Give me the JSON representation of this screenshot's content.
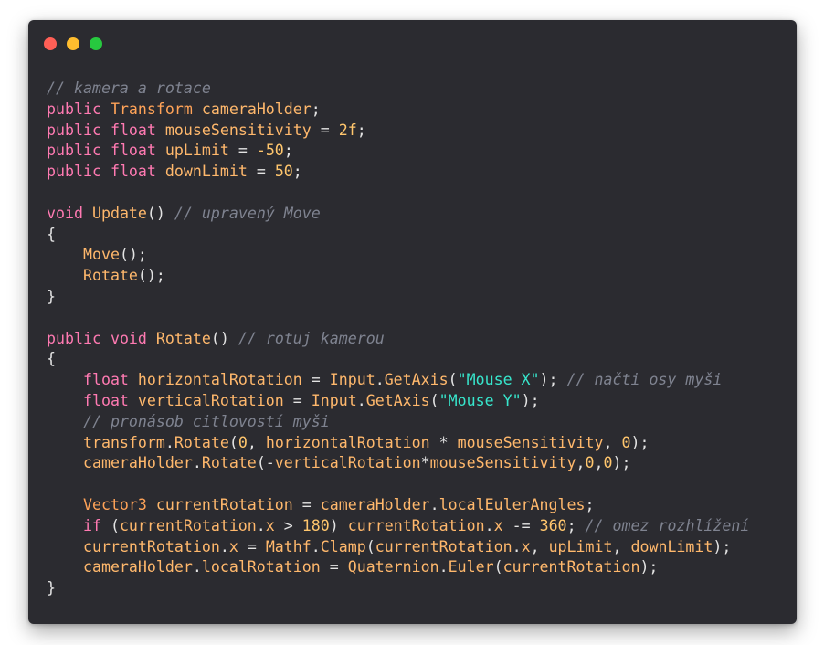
{
  "window": {
    "controls": [
      {
        "name": "close",
        "color": "#ff5f56"
      },
      {
        "name": "minimize",
        "color": "#ffbd2e"
      },
      {
        "name": "maximize",
        "color": "#27c93f"
      }
    ]
  },
  "colors": {
    "background": "#2b2b30",
    "keyword": "#ff7ab2",
    "identifier": "#ffb86c",
    "number": "#ffc66d",
    "string": "#37e6cc",
    "comment": "#7f8390",
    "plain": "#e3e3e3"
  },
  "code": {
    "lines": [
      [
        [
          "cm",
          "// kamera a rotace"
        ]
      ],
      [
        [
          "kw",
          "public"
        ],
        [
          "pl",
          " "
        ],
        [
          "ty",
          "Transform"
        ],
        [
          "pl",
          " "
        ],
        [
          "id",
          "cameraHolder"
        ],
        [
          "pl",
          ";"
        ]
      ],
      [
        [
          "kw",
          "public"
        ],
        [
          "pl",
          " "
        ],
        [
          "kw",
          "float"
        ],
        [
          "pl",
          " "
        ],
        [
          "id",
          "mouseSensitivity"
        ],
        [
          "pl",
          " = "
        ],
        [
          "nm",
          "2f"
        ],
        [
          "pl",
          ";"
        ]
      ],
      [
        [
          "kw",
          "public"
        ],
        [
          "pl",
          " "
        ],
        [
          "kw",
          "float"
        ],
        [
          "pl",
          " "
        ],
        [
          "id",
          "upLimit"
        ],
        [
          "pl",
          " = "
        ],
        [
          "nm",
          "-50"
        ],
        [
          "pl",
          ";"
        ]
      ],
      [
        [
          "kw",
          "public"
        ],
        [
          "pl",
          " "
        ],
        [
          "kw",
          "float"
        ],
        [
          "pl",
          " "
        ],
        [
          "id",
          "downLimit"
        ],
        [
          "pl",
          " = "
        ],
        [
          "nm",
          "50"
        ],
        [
          "pl",
          ";"
        ]
      ],
      [],
      [
        [
          "kw",
          "void"
        ],
        [
          "pl",
          " "
        ],
        [
          "fn",
          "Update"
        ],
        [
          "pl",
          "() "
        ],
        [
          "cm",
          "// upravený Move"
        ]
      ],
      [
        [
          "pl",
          "{"
        ]
      ],
      [
        [
          "pl",
          "    "
        ],
        [
          "fn",
          "Move"
        ],
        [
          "pl",
          "();"
        ]
      ],
      [
        [
          "pl",
          "    "
        ],
        [
          "fn",
          "Rotate"
        ],
        [
          "pl",
          "();"
        ]
      ],
      [
        [
          "pl",
          "}"
        ]
      ],
      [],
      [
        [
          "kw",
          "public"
        ],
        [
          "pl",
          " "
        ],
        [
          "kw",
          "void"
        ],
        [
          "pl",
          " "
        ],
        [
          "fn",
          "Rotate"
        ],
        [
          "pl",
          "() "
        ],
        [
          "cm",
          "// rotuj kamerou"
        ]
      ],
      [
        [
          "pl",
          "{"
        ]
      ],
      [
        [
          "pl",
          "    "
        ],
        [
          "kw",
          "float"
        ],
        [
          "pl",
          " "
        ],
        [
          "id",
          "horizontalRotation"
        ],
        [
          "pl",
          " = "
        ],
        [
          "id",
          "Input"
        ],
        [
          "pl",
          "."
        ],
        [
          "fn",
          "GetAxis"
        ],
        [
          "pl",
          "("
        ],
        [
          "st",
          "\"Mouse X\""
        ],
        [
          "pl",
          "); "
        ],
        [
          "cm",
          "// načti osy myši"
        ]
      ],
      [
        [
          "pl",
          "    "
        ],
        [
          "kw",
          "float"
        ],
        [
          "pl",
          " "
        ],
        [
          "id",
          "verticalRotation"
        ],
        [
          "pl",
          " = "
        ],
        [
          "id",
          "Input"
        ],
        [
          "pl",
          "."
        ],
        [
          "fn",
          "GetAxis"
        ],
        [
          "pl",
          "("
        ],
        [
          "st",
          "\"Mouse Y\""
        ],
        [
          "pl",
          ");"
        ]
      ],
      [
        [
          "pl",
          "    "
        ],
        [
          "cm",
          "// pronásob citlovostí myši"
        ]
      ],
      [
        [
          "pl",
          "    "
        ],
        [
          "id",
          "transform"
        ],
        [
          "pl",
          "."
        ],
        [
          "fn",
          "Rotate"
        ],
        [
          "pl",
          "("
        ],
        [
          "nm",
          "0"
        ],
        [
          "pl",
          ", "
        ],
        [
          "id",
          "horizontalRotation"
        ],
        [
          "pl",
          " * "
        ],
        [
          "id",
          "mouseSensitivity"
        ],
        [
          "pl",
          ", "
        ],
        [
          "nm",
          "0"
        ],
        [
          "pl",
          ");"
        ]
      ],
      [
        [
          "pl",
          "    "
        ],
        [
          "id",
          "cameraHolder"
        ],
        [
          "pl",
          "."
        ],
        [
          "fn",
          "Rotate"
        ],
        [
          "pl",
          "(-"
        ],
        [
          "id",
          "verticalRotation"
        ],
        [
          "pl",
          "*"
        ],
        [
          "id",
          "mouseSensitivity"
        ],
        [
          "pl",
          ","
        ],
        [
          "nm",
          "0"
        ],
        [
          "pl",
          ","
        ],
        [
          "nm",
          "0"
        ],
        [
          "pl",
          ");"
        ]
      ],
      [],
      [
        [
          "pl",
          "    "
        ],
        [
          "ty",
          "Vector3"
        ],
        [
          "pl",
          " "
        ],
        [
          "id",
          "currentRotation"
        ],
        [
          "pl",
          " = "
        ],
        [
          "id",
          "cameraHolder"
        ],
        [
          "pl",
          "."
        ],
        [
          "id",
          "localEulerAngles"
        ],
        [
          "pl",
          ";"
        ]
      ],
      [
        [
          "pl",
          "    "
        ],
        [
          "kw",
          "if"
        ],
        [
          "pl",
          " ("
        ],
        [
          "id",
          "currentRotation"
        ],
        [
          "pl",
          "."
        ],
        [
          "id",
          "x"
        ],
        [
          "pl",
          " > "
        ],
        [
          "nm",
          "180"
        ],
        [
          "pl",
          ") "
        ],
        [
          "id",
          "currentRotation"
        ],
        [
          "pl",
          "."
        ],
        [
          "id",
          "x"
        ],
        [
          "pl",
          " -= "
        ],
        [
          "nm",
          "360"
        ],
        [
          "pl",
          "; "
        ],
        [
          "cm",
          "// omez rozhlížení"
        ]
      ],
      [
        [
          "pl",
          "    "
        ],
        [
          "id",
          "currentRotation"
        ],
        [
          "pl",
          "."
        ],
        [
          "id",
          "x"
        ],
        [
          "pl",
          " = "
        ],
        [
          "id",
          "Mathf"
        ],
        [
          "pl",
          "."
        ],
        [
          "fn",
          "Clamp"
        ],
        [
          "pl",
          "("
        ],
        [
          "id",
          "currentRotation"
        ],
        [
          "pl",
          "."
        ],
        [
          "id",
          "x"
        ],
        [
          "pl",
          ", "
        ],
        [
          "id",
          "upLimit"
        ],
        [
          "pl",
          ", "
        ],
        [
          "id",
          "downLimit"
        ],
        [
          "pl",
          ");"
        ]
      ],
      [
        [
          "pl",
          "    "
        ],
        [
          "id",
          "cameraHolder"
        ],
        [
          "pl",
          "."
        ],
        [
          "id",
          "localRotation"
        ],
        [
          "pl",
          " = "
        ],
        [
          "id",
          "Quaternion"
        ],
        [
          "pl",
          "."
        ],
        [
          "fn",
          "Euler"
        ],
        [
          "pl",
          "("
        ],
        [
          "id",
          "currentRotation"
        ],
        [
          "pl",
          ");"
        ]
      ],
      [
        [
          "pl",
          "}"
        ]
      ]
    ]
  }
}
